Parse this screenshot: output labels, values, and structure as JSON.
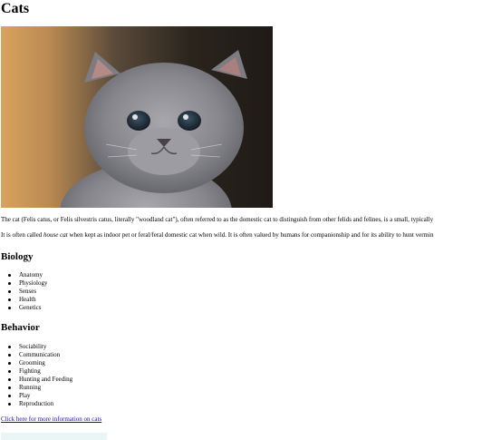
{
  "title": "Cats",
  "hero_image": {
    "subject": "grey kitten",
    "colors": {
      "background_warm": "#d9a25f",
      "background_dark": "#1f1a16",
      "fur": "#8a8a8f",
      "eye": "#1e2a34"
    }
  },
  "intro": {
    "paragraph1": "The cat (Felis catus, or Felis silvestris catus, literally \"woodland cat\"), often referred to as the domestic cat to distinguish from other felids and felines, is a small, typically",
    "paragraph2_before_em": "It is often called ",
    "paragraph2_em": "house cat",
    "paragraph2_after_em": " when kept as indoor pet or feral/feral domestic cat when wild. It is often valued by humans for companionship and for its ability to hunt vermin"
  },
  "sections": [
    {
      "heading": "Biology",
      "items": [
        "Anatomy",
        "Physiology",
        "Senses",
        "Health",
        "Genetics"
      ]
    },
    {
      "heading": "Behavior",
      "items": [
        "Sociability",
        "Communication",
        "Grooming",
        "Fighting",
        "Hunting and Feeding",
        "Running",
        "Play",
        "Reproduction"
      ]
    }
  ],
  "more_link": {
    "label": "Click here for more information on cats",
    "color": "#1a0dab"
  },
  "footer": {
    "strip_color": "#eaf6f6"
  }
}
